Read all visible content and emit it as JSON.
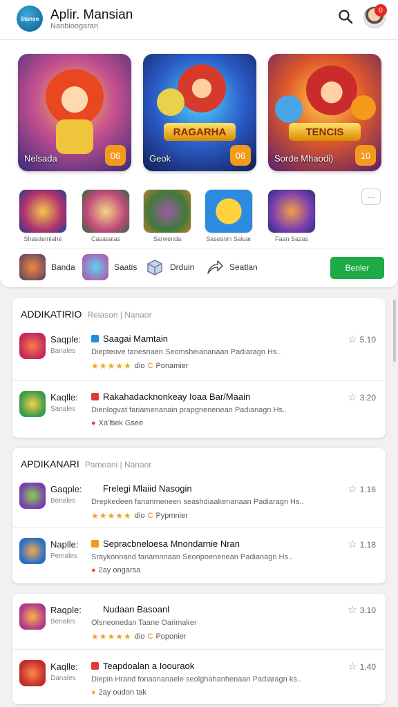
{
  "header": {
    "logo_text": "Stanso",
    "title": "Aplir. Mansian",
    "subtitle": "Nanbioogaran",
    "search_icon": "search-icon",
    "notification_count": "0"
  },
  "featured": [
    {
      "label": "Nelsada",
      "number": "06",
      "banner": ""
    },
    {
      "label": "Geok",
      "number": "06",
      "banner": "RAGARHA"
    },
    {
      "label": "Sorde Mhaodi)",
      "number": "10",
      "banner": "TENCIS"
    }
  ],
  "tiles": [
    {
      "caption": "Shasdemlahe"
    },
    {
      "caption": "Casasalas"
    },
    {
      "caption": "Sarwenda"
    },
    {
      "caption": "Sasesnin Saluar"
    },
    {
      "caption": "Faan Sazas"
    }
  ],
  "more_label": "···",
  "categories": [
    {
      "label": "Banda"
    },
    {
      "label": "Saatis"
    },
    {
      "label": "Drduin"
    },
    {
      "label": "Seatlan"
    }
  ],
  "get_button": "Benler",
  "sections": [
    {
      "heading": "ADDIKATIRIO",
      "subheading": "Reiason | Nanaor",
      "rows": [
        {
          "k1": "Saqple:",
          "k2": "Banales",
          "title": "Saagai Mamtain",
          "desc": "Diepteuve tanesnaen Seomsheiananaan Padiaragn Hs..",
          "meta_icon": "",
          "meta_text": "dio",
          "meta_tail": "Ponamier",
          "rating": "5.10",
          "stars": "★★★★★"
        },
        {
          "k1": "Kaqlle:",
          "k2": "Sanales",
          "title": "Rakahadacknonkeay Ioaa Bar/Maain",
          "desc": "Dienlogvat fariamenanain prapgnenenean Padianagn Hs..",
          "meta_icon": "●",
          "meta_text": "Xa'ltiek Gsee",
          "meta_tail": "",
          "rating": "3.20",
          "stars": ""
        }
      ]
    },
    {
      "heading": "APDIKANARI",
      "subheading": "Pameani | Nanaor",
      "rows": [
        {
          "k1": "Gaqple:",
          "k2": "Benales",
          "title": "Frelegi Mlaiid Nasogin",
          "desc": "Drepkedeen fananmeneen seashdiaakenanaan Padiaragn Hs..",
          "meta_icon": "",
          "meta_text": "dio",
          "meta_tail": "Pypmnier",
          "rating": "1.16",
          "stars": "★★★★★"
        },
        {
          "k1": "Naplle:",
          "k2": "Pemales",
          "title": "Sepracbneloesa Mnondarnie Nran",
          "desc": "Sraykonnand fariamnnaan Seonpoenenean Padianagn Hs..",
          "meta_icon": "●",
          "meta_text": "2ay ongarsa",
          "meta_tail": "",
          "rating": "1.18",
          "stars": ""
        }
      ]
    },
    {
      "heading": "",
      "subheading": "",
      "rows": [
        {
          "k1": "Raqple:",
          "k2": "Benales",
          "title": "Nudaan Basoanl",
          "desc": "Olsneonedan Taane Oarimaker",
          "meta_icon": "",
          "meta_text": "dio",
          "meta_tail": "Poponier",
          "rating": "3.10",
          "stars": "★★★★★"
        },
        {
          "k1": "Kaqlle:",
          "k2": "Danales",
          "title": "Teapdoalan a Ioouraok",
          "desc": "Diepin Hrand fonaonanaele seolghahanhenaan Padiaragn ks..",
          "meta_icon": "●",
          "meta_text": "2ay oudon tak",
          "meta_tail": "",
          "rating": "1.40",
          "stars": ""
        }
      ]
    }
  ]
}
